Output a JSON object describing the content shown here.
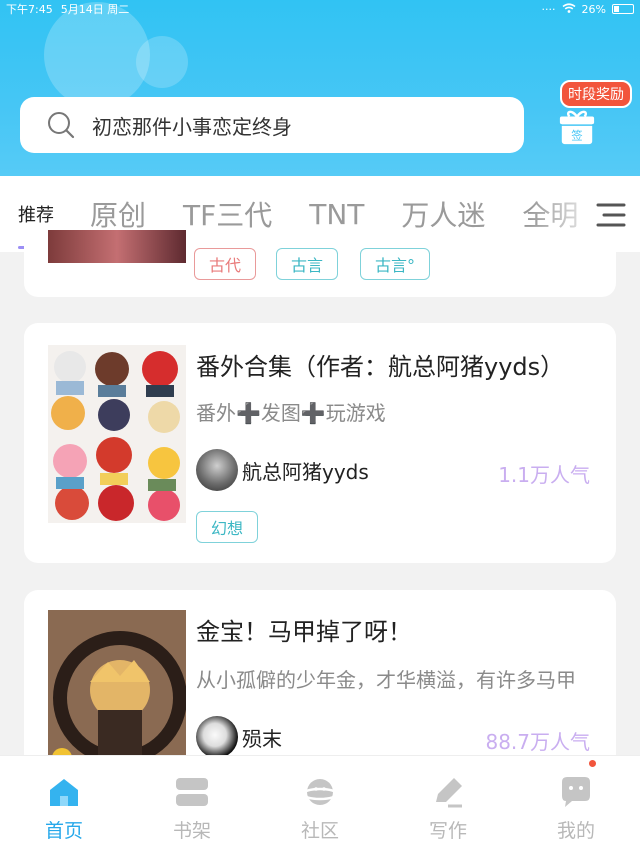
{
  "status": {
    "time": "下午7:45",
    "date": "5月14日 周二",
    "battery": "26%"
  },
  "search": {
    "text": "初恋那件小事恋定终身"
  },
  "reward": {
    "label": "时段奖励",
    "gift_text": "签"
  },
  "tabs": [
    "推荐",
    "原创",
    "TF三代",
    "TNT",
    "万人迷",
    "全明"
  ],
  "feed": [
    {
      "tags": [
        {
          "label": "古代",
          "color": "#e97b7b"
        },
        {
          "label": "古言",
          "color": "#3cb7c4"
        },
        {
          "label": "古言°",
          "color": "#3cb7c4"
        }
      ]
    },
    {
      "title": "番外合集（作者：航总阿猪yyds）",
      "desc": "番外➕发图➕玩游戏",
      "author": "航总阿猪yyds",
      "popularity": "1.1万人气",
      "tag": "幻想"
    },
    {
      "title": "金宝！马甲掉了呀！",
      "desc": "从小孤僻的少年金，才华横溢，有许多马甲",
      "author": "殒末",
      "popularity": "88.7万人气"
    }
  ],
  "nav": [
    {
      "label": "首页",
      "icon": "home-icon",
      "active": true
    },
    {
      "label": "书架",
      "icon": "bookshelf-icon"
    },
    {
      "label": "社区",
      "icon": "community-planet-icon"
    },
    {
      "label": "写作",
      "icon": "pen-write-icon"
    },
    {
      "label": "我的",
      "icon": "chat-profile-icon"
    }
  ],
  "colors": {
    "accent": "#27a8ea",
    "header": "#3ec4f4",
    "popularity": "#c9aef0",
    "underline": "#9c8ff5"
  }
}
